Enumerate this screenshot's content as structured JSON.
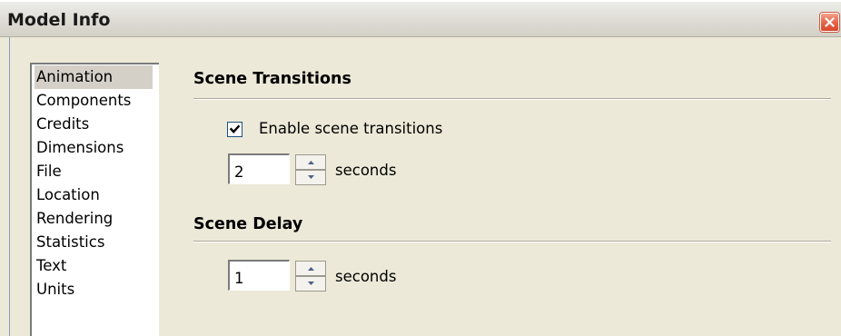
{
  "window": {
    "title": "Model Info",
    "close_icon": "close-icon"
  },
  "sidebar": {
    "selected": "Animation",
    "items": [
      {
        "label": "Animation"
      },
      {
        "label": "Components"
      },
      {
        "label": "Credits"
      },
      {
        "label": "Dimensions"
      },
      {
        "label": "File"
      },
      {
        "label": "Location"
      },
      {
        "label": "Rendering"
      },
      {
        "label": "Statistics"
      },
      {
        "label": "Text"
      },
      {
        "label": "Units"
      }
    ]
  },
  "scene_transitions": {
    "heading": "Scene Transitions",
    "enable_label": "Enable scene transitions",
    "enabled": true,
    "value": "2",
    "unit": "seconds"
  },
  "scene_delay": {
    "heading": "Scene Delay",
    "value": "1",
    "unit": "seconds"
  },
  "colors": {
    "background": "#ece9d8",
    "close_button": "#e5674a",
    "checkbox_border": "#1c5180",
    "checkmark": "#21a121"
  }
}
